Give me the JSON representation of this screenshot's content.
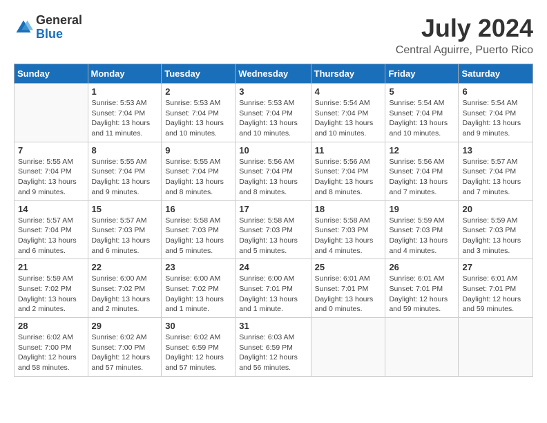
{
  "header": {
    "logo": {
      "general": "General",
      "blue": "Blue"
    },
    "title": "July 2024",
    "location": "Central Aguirre, Puerto Rico"
  },
  "calendar": {
    "days_of_week": [
      "Sunday",
      "Monday",
      "Tuesday",
      "Wednesday",
      "Thursday",
      "Friday",
      "Saturday"
    ],
    "weeks": [
      [
        {
          "day": "",
          "info": ""
        },
        {
          "day": "1",
          "info": "Sunrise: 5:53 AM\nSunset: 7:04 PM\nDaylight: 13 hours\nand 11 minutes."
        },
        {
          "day": "2",
          "info": "Sunrise: 5:53 AM\nSunset: 7:04 PM\nDaylight: 13 hours\nand 10 minutes."
        },
        {
          "day": "3",
          "info": "Sunrise: 5:53 AM\nSunset: 7:04 PM\nDaylight: 13 hours\nand 10 minutes."
        },
        {
          "day": "4",
          "info": "Sunrise: 5:54 AM\nSunset: 7:04 PM\nDaylight: 13 hours\nand 10 minutes."
        },
        {
          "day": "5",
          "info": "Sunrise: 5:54 AM\nSunset: 7:04 PM\nDaylight: 13 hours\nand 10 minutes."
        },
        {
          "day": "6",
          "info": "Sunrise: 5:54 AM\nSunset: 7:04 PM\nDaylight: 13 hours\nand 9 minutes."
        }
      ],
      [
        {
          "day": "7",
          "info": "Sunrise: 5:55 AM\nSunset: 7:04 PM\nDaylight: 13 hours\nand 9 minutes."
        },
        {
          "day": "8",
          "info": "Sunrise: 5:55 AM\nSunset: 7:04 PM\nDaylight: 13 hours\nand 9 minutes."
        },
        {
          "day": "9",
          "info": "Sunrise: 5:55 AM\nSunset: 7:04 PM\nDaylight: 13 hours\nand 8 minutes."
        },
        {
          "day": "10",
          "info": "Sunrise: 5:56 AM\nSunset: 7:04 PM\nDaylight: 13 hours\nand 8 minutes."
        },
        {
          "day": "11",
          "info": "Sunrise: 5:56 AM\nSunset: 7:04 PM\nDaylight: 13 hours\nand 8 minutes."
        },
        {
          "day": "12",
          "info": "Sunrise: 5:56 AM\nSunset: 7:04 PM\nDaylight: 13 hours\nand 7 minutes."
        },
        {
          "day": "13",
          "info": "Sunrise: 5:57 AM\nSunset: 7:04 PM\nDaylight: 13 hours\nand 7 minutes."
        }
      ],
      [
        {
          "day": "14",
          "info": "Sunrise: 5:57 AM\nSunset: 7:04 PM\nDaylight: 13 hours\nand 6 minutes."
        },
        {
          "day": "15",
          "info": "Sunrise: 5:57 AM\nSunset: 7:03 PM\nDaylight: 13 hours\nand 6 minutes."
        },
        {
          "day": "16",
          "info": "Sunrise: 5:58 AM\nSunset: 7:03 PM\nDaylight: 13 hours\nand 5 minutes."
        },
        {
          "day": "17",
          "info": "Sunrise: 5:58 AM\nSunset: 7:03 PM\nDaylight: 13 hours\nand 5 minutes."
        },
        {
          "day": "18",
          "info": "Sunrise: 5:58 AM\nSunset: 7:03 PM\nDaylight: 13 hours\nand 4 minutes."
        },
        {
          "day": "19",
          "info": "Sunrise: 5:59 AM\nSunset: 7:03 PM\nDaylight: 13 hours\nand 4 minutes."
        },
        {
          "day": "20",
          "info": "Sunrise: 5:59 AM\nSunset: 7:03 PM\nDaylight: 13 hours\nand 3 minutes."
        }
      ],
      [
        {
          "day": "21",
          "info": "Sunrise: 5:59 AM\nSunset: 7:02 PM\nDaylight: 13 hours\nand 2 minutes."
        },
        {
          "day": "22",
          "info": "Sunrise: 6:00 AM\nSunset: 7:02 PM\nDaylight: 13 hours\nand 2 minutes."
        },
        {
          "day": "23",
          "info": "Sunrise: 6:00 AM\nSunset: 7:02 PM\nDaylight: 13 hours\nand 1 minute."
        },
        {
          "day": "24",
          "info": "Sunrise: 6:00 AM\nSunset: 7:01 PM\nDaylight: 13 hours\nand 1 minute."
        },
        {
          "day": "25",
          "info": "Sunrise: 6:01 AM\nSunset: 7:01 PM\nDaylight: 13 hours\nand 0 minutes."
        },
        {
          "day": "26",
          "info": "Sunrise: 6:01 AM\nSunset: 7:01 PM\nDaylight: 12 hours\nand 59 minutes."
        },
        {
          "day": "27",
          "info": "Sunrise: 6:01 AM\nSunset: 7:01 PM\nDaylight: 12 hours\nand 59 minutes."
        }
      ],
      [
        {
          "day": "28",
          "info": "Sunrise: 6:02 AM\nSunset: 7:00 PM\nDaylight: 12 hours\nand 58 minutes."
        },
        {
          "day": "29",
          "info": "Sunrise: 6:02 AM\nSunset: 7:00 PM\nDaylight: 12 hours\nand 57 minutes."
        },
        {
          "day": "30",
          "info": "Sunrise: 6:02 AM\nSunset: 6:59 PM\nDaylight: 12 hours\nand 57 minutes."
        },
        {
          "day": "31",
          "info": "Sunrise: 6:03 AM\nSunset: 6:59 PM\nDaylight: 12 hours\nand 56 minutes."
        },
        {
          "day": "",
          "info": ""
        },
        {
          "day": "",
          "info": ""
        },
        {
          "day": "",
          "info": ""
        }
      ]
    ]
  }
}
